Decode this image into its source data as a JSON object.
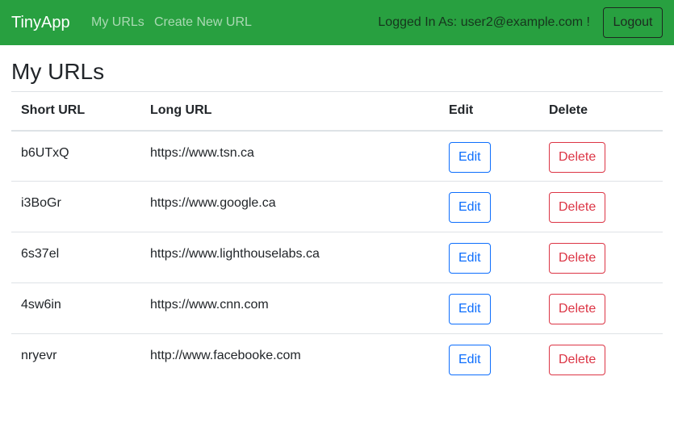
{
  "navbar": {
    "brand": "TinyApp",
    "links": [
      "My URLs",
      "Create New URL"
    ],
    "logged_in_text": "Logged In As: user2@example.com !",
    "logout_label": "Logout"
  },
  "colors": {
    "navbar_bg": "#28a040",
    "edit_accent": "#0d6efd",
    "delete_accent": "#dc3545"
  },
  "page": {
    "title": "My URLs"
  },
  "table": {
    "headers": [
      "Short URL",
      "Long URL",
      "Edit",
      "Delete"
    ],
    "rows": [
      {
        "short": "b6UTxQ",
        "long": "https://www.tsn.ca",
        "edit": "Edit",
        "delete": "Delete"
      },
      {
        "short": "i3BoGr",
        "long": "https://www.google.ca",
        "edit": "Edit",
        "delete": "Delete"
      },
      {
        "short": "6s37el",
        "long": "https://www.lighthouselabs.ca",
        "edit": "Edit",
        "delete": "Delete"
      },
      {
        "short": "4sw6in",
        "long": "https://www.cnn.com",
        "edit": "Edit",
        "delete": "Delete"
      },
      {
        "short": "nryevr",
        "long": "http://www.facebooke.com",
        "edit": "Edit",
        "delete": "Delete"
      }
    ]
  }
}
